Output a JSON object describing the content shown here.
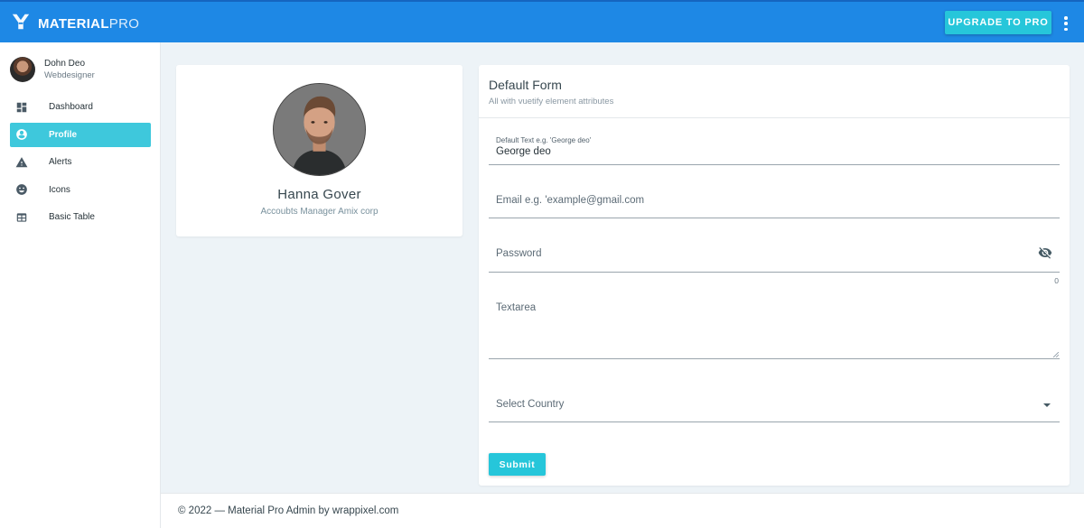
{
  "header": {
    "brand_bold": "MATERIAL",
    "brand_light": "PRO",
    "upgrade_label": "UPGRADE TO PRO",
    "menu_icon": "dots-vertical-icon",
    "color": "#1e88e5"
  },
  "sidebar": {
    "user": {
      "name": "Dohn Deo",
      "role": "Webdesigner"
    },
    "items": [
      {
        "label": "Dashboard",
        "icon": "dashboard-icon",
        "active": false
      },
      {
        "label": "Profile",
        "icon": "account-circle-icon",
        "active": true
      },
      {
        "label": "Alerts",
        "icon": "alert-icon",
        "active": false
      },
      {
        "label": "Icons",
        "icon": "emoticon-icon",
        "active": false
      },
      {
        "label": "Basic Table",
        "icon": "table-icon",
        "active": false
      }
    ],
    "active_color": "#3ec8dc"
  },
  "profile": {
    "name": "Hanna Gover",
    "role": "Accoubts Manager Amix corp"
  },
  "form": {
    "title": "Default Form",
    "subtitle": "All with vuetify element attributes",
    "text_field": {
      "label": "Default Text e.g. 'George deo'",
      "value": "George deo"
    },
    "email_field": {
      "placeholder": "Email e.g. 'example@gmail.com"
    },
    "password_field": {
      "placeholder": "Password",
      "counter": "0",
      "icon": "eye-off-icon"
    },
    "textarea": {
      "placeholder": "Textarea"
    },
    "country_select": {
      "placeholder": "Select Country",
      "icon": "menu-down-icon"
    },
    "submit_label": "Submit",
    "button_color": "#26c6da"
  },
  "footer": {
    "text": "© 2022 — Material Pro Admin by wrappixel.com"
  }
}
